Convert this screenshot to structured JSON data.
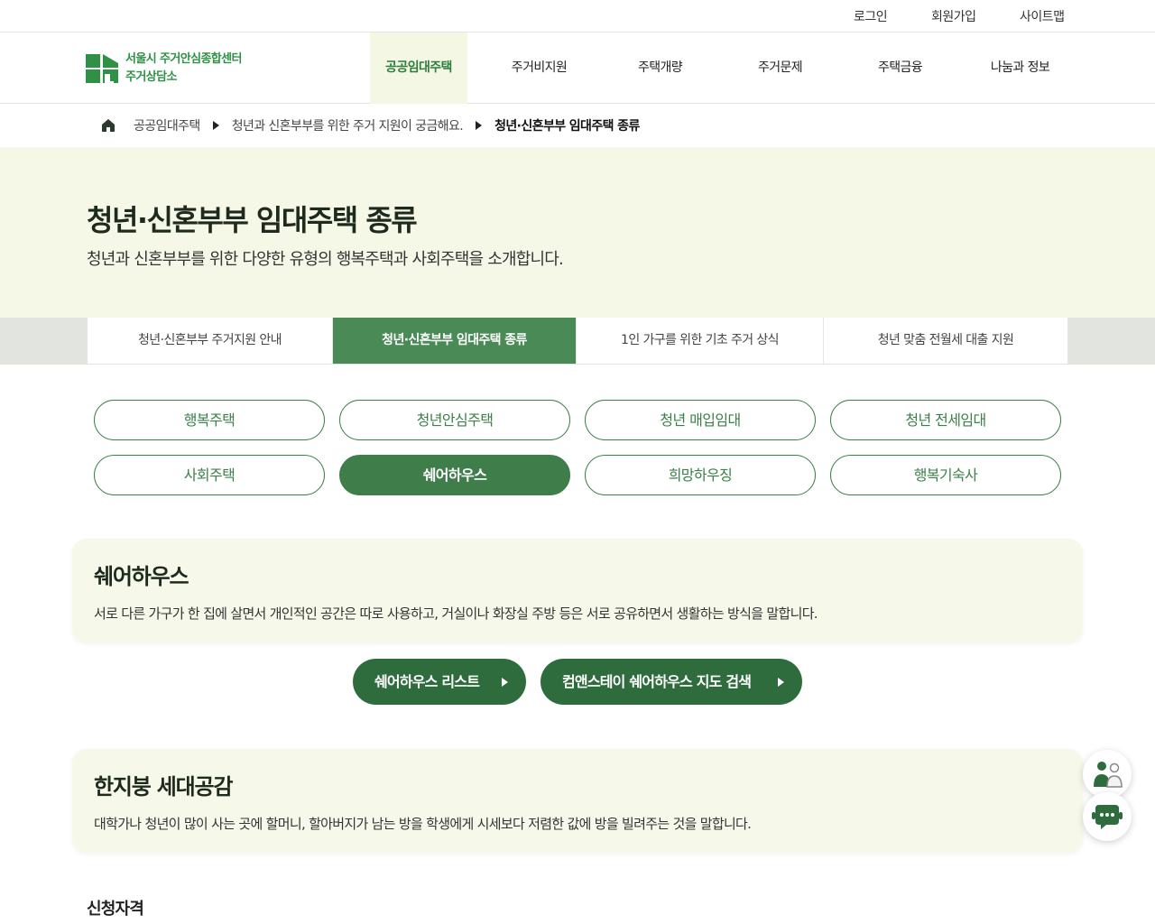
{
  "util_nav": {
    "login": "로그인",
    "signup": "회원가입",
    "sitemap": "사이트맵"
  },
  "logo": {
    "line1": "서울시 주거안심종합센터",
    "line2": "주거상담소"
  },
  "gnb": [
    "공공임대주택",
    "주거비지원",
    "주택개량",
    "주거문제",
    "주택금융",
    "나눔과 정보"
  ],
  "breadcrumb": [
    "공공임대주택",
    "청년과 신혼부부를 위한 주거 지원이 궁금해요.",
    "청년·신혼부부 임대주택 종류"
  ],
  "hero": {
    "title": "청년·신혼부부 임대주택 종류",
    "subtitle": "청년과 신혼부부를 위한 다양한 유형의 행복주택과 사회주택을 소개합니다."
  },
  "tabs": [
    "청년·신혼부부 주거지원 안내",
    "청년·신혼부부 임대주택 종류",
    "1인 가구를 위한 기초 주거 상식",
    "청년 맞춤 전월세 대출 지원"
  ],
  "types": [
    "행복주택",
    "청년안심주택",
    "청년 매입임대",
    "청년 전세임대",
    "사회주택",
    "쉐어하우스",
    "희망하우징",
    "행복기숙사"
  ],
  "cards": [
    {
      "title": "쉐어하우스",
      "desc": "서로 다른 가구가 한 집에 살면서 개인적인 공간은 따로 사용하고, 거실이나 화장실 주방 등은 서로 공유하면서 생활하는 방식을 말합니다."
    },
    {
      "title": "한지붕 세대공감",
      "desc": "대학가나 청년이 많이 사는 곳에 할머니, 할아버지가 남는 방을 학생에게 시세보다 저렴한 값에 방을 빌려주는 것을 말합니다."
    }
  ],
  "actions": {
    "sharehouse_list": "쉐어하우스 리스트",
    "map_search": "컴앤스테이 쉐어하우스 지도 검색"
  },
  "section": {
    "eligibility": "신청자격"
  },
  "icons": {
    "home": "home-icon",
    "consult": "people-consult-icon",
    "chat": "chatbot-icon"
  },
  "colors": {
    "brand": "#2e9145",
    "active_tab": "#4a8a56",
    "pill_active": "#3f7d4b",
    "hero_bg": "#f5f8e6"
  }
}
